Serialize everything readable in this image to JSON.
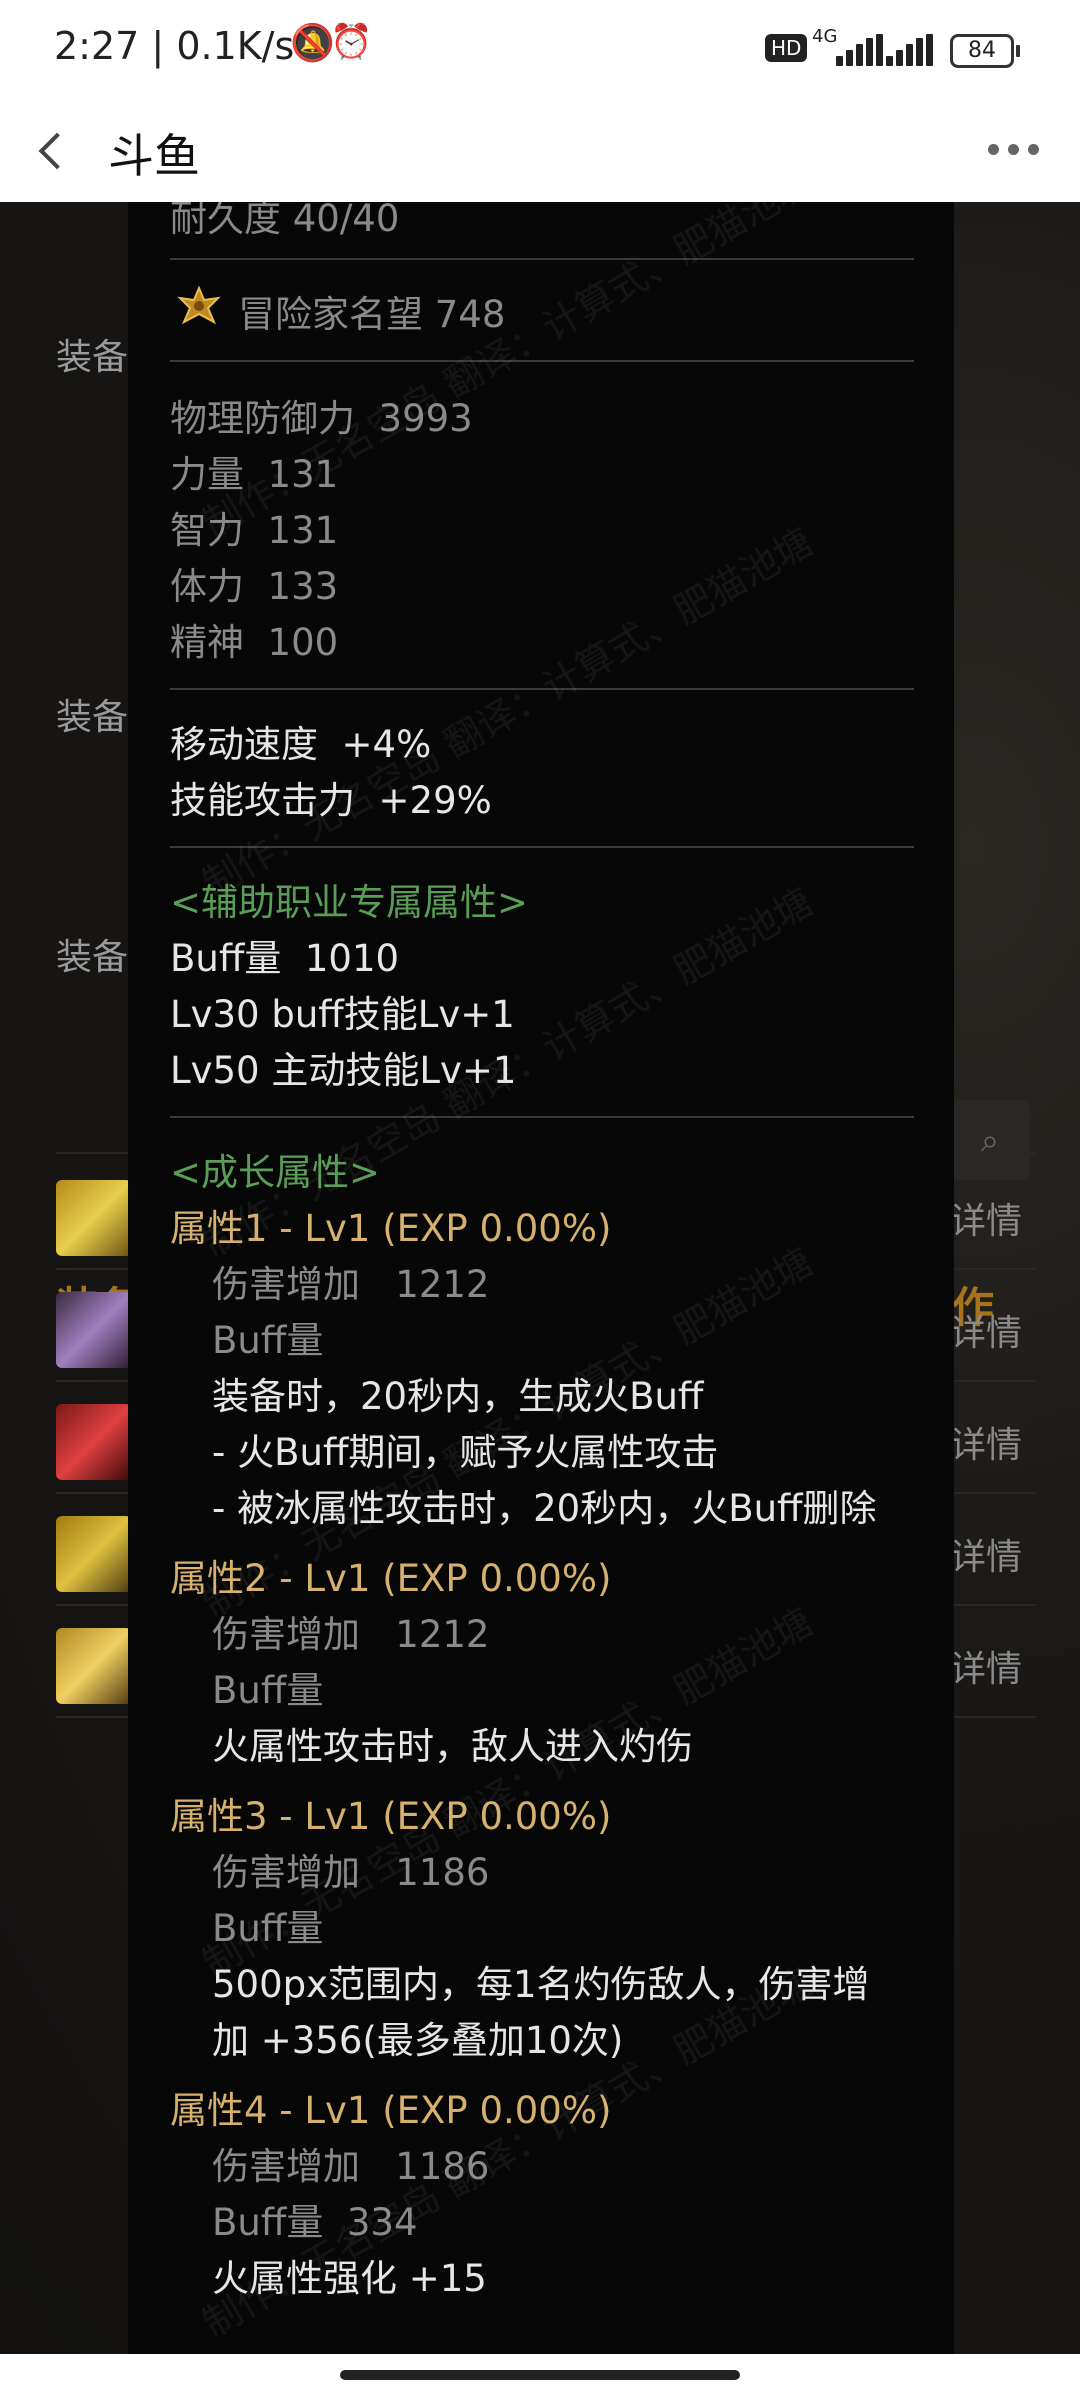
{
  "status_bar": {
    "time": "2:27",
    "net_speed": "0.1K/s",
    "hd": "HD",
    "network": "4G",
    "battery": "84"
  },
  "nav": {
    "title": "斗鱼"
  },
  "background": {
    "labels": [
      "装备",
      "装备",
      "装备"
    ],
    "section_left": "装备",
    "section_right": "作",
    "detail_label": "详情"
  },
  "tooltip": {
    "durability": "耐久度 40/40",
    "reputation": "冒险家名望 748",
    "stats": [
      {
        "name": "物理防御力",
        "value": "3993"
      },
      {
        "name": "力量",
        "value": "131"
      },
      {
        "name": "智力",
        "value": "131"
      },
      {
        "name": "体力",
        "value": "133"
      },
      {
        "name": "精神",
        "value": "100"
      }
    ],
    "bonuses": [
      {
        "name": "移动速度",
        "value": "+4%"
      },
      {
        "name": "技能攻击力",
        "value": "+29%"
      }
    ],
    "support": {
      "header": "<辅助职业专属属性>",
      "buff_label": "Buff量",
      "buff_value": "1010",
      "line1": "Lv30 buff技能Lv+1",
      "line2": "Lv50 主动技能Lv+1"
    },
    "growth": {
      "header": "<成长属性>",
      "attr1": {
        "title": "属性1 - Lv1 (EXP 0.00%)",
        "dmg_label": "伤害增加",
        "dmg_value": "1212",
        "buff": "Buff量",
        "desc1": "装备时，20秒内，生成火Buff",
        "desc2": "- 火Buff期间，赋予火属性攻击",
        "desc3": "- 被冰属性攻击时，20秒内，火Buff删除"
      },
      "attr2": {
        "title": "属性2 - Lv1 (EXP 0.00%)",
        "dmg_label": "伤害增加",
        "dmg_value": "1212",
        "buff": "Buff量",
        "desc1": "火属性攻击时，敌人进入灼伤"
      },
      "attr3": {
        "title": "属性3 - Lv1 (EXP 0.00%)",
        "dmg_label": "伤害增加",
        "dmg_value": "1186",
        "buff": "Buff量",
        "desc1": "500px范围内，每1名灼伤敌人，伤害增",
        "desc2": "加 +356(最多叠加10次)"
      },
      "attr4": {
        "title": "属性4 - Lv1 (EXP 0.00%)",
        "dmg_label": "伤害增加",
        "dmg_value": "1186",
        "buff_label": "Buff量",
        "buff_value": "334",
        "desc1": "火属性强化 +15"
      }
    }
  },
  "watermark": "制作：无名空岛 翻译：计算式、肥猫池塘",
  "colors": {
    "grey_text": "#8a8a8a",
    "white_text": "#e6e6e6",
    "green_header": "#5a9d57",
    "gold_attr": "#d6b06e",
    "section_gold": "#a8741a"
  }
}
